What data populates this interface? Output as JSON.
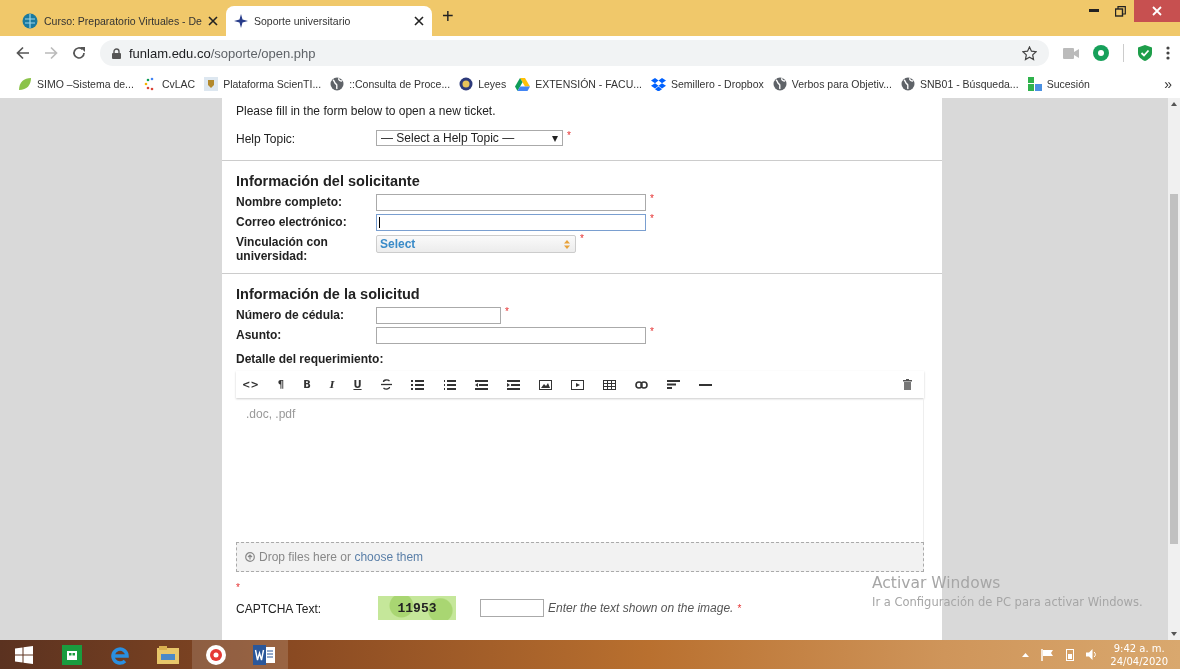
{
  "tabs": [
    {
      "title": "Curso: Preparatorio Virtuales - De",
      "selected": false
    },
    {
      "title": "Soporte universitario",
      "selected": true
    }
  ],
  "new_tab": "+",
  "address": {
    "host": "funlam.edu.co",
    "path": "/soporte/open.php"
  },
  "bookmarks": [
    {
      "label": "SIMO –Sistema de..."
    },
    {
      "label": "CvLAC"
    },
    {
      "label": "Plataforma ScienTI..."
    },
    {
      "label": "::Consulta de Proce..."
    },
    {
      "label": "Leyes"
    },
    {
      "label": "EXTENSIÓN - FACU..."
    },
    {
      "label": "Semillero - Dropbox"
    },
    {
      "label": "Verbos para Objetiv..."
    },
    {
      "label": "SNB01 - Búsqueda..."
    },
    {
      "label": "Sucesión"
    }
  ],
  "bookmarks_more": "»",
  "form": {
    "intro": "Please fill in the form below to open a new ticket.",
    "help_topic": {
      "label": "Help Topic:",
      "value": "— Select a Help Topic —",
      "arrow": "▾",
      "required_mark": "*"
    },
    "sections": [
      {
        "title": "Información del solicitante",
        "fields": [
          {
            "label": "Nombre completo:",
            "kind": "longinput",
            "focused": false,
            "required_mark": "*"
          },
          {
            "label": "Correo electrónico:",
            "kind": "longinput",
            "focused": true,
            "required_mark": "*"
          },
          {
            "label": "Vinculación con universidad:",
            "kind": "select",
            "value": "Select",
            "required_mark": "*"
          }
        ]
      },
      {
        "title": "Información de la solicitud",
        "fields": [
          {
            "label": "Número de cédula:",
            "kind": "shortinput",
            "focused": false,
            "required_mark": "*"
          },
          {
            "label": "Asunto:",
            "kind": "longinput",
            "focused": false,
            "required_mark": "*"
          }
        ]
      }
    ],
    "editor": {
      "label": "**Detalle del requerimiento**:",
      "toolbar_glyphs": [
        "<>",
        "¶",
        "B",
        "I",
        "U"
      ],
      "placeholder": ".doc, .pdf",
      "drop_text": "Drop files here or ",
      "drop_link": "choose them"
    },
    "captcha": {
      "required_mark": "*",
      "label": "CAPTCHA Text:",
      "code": "11953",
      "hint": "Enter the text shown on the image.",
      "hint_mark": "*"
    }
  },
  "activation": {
    "title": "Activar Windows",
    "subtitle": "Ir a Configuración de PC para activar Windows."
  },
  "taskbar": {
    "time": "9:42 a. m.",
    "date": "24/04/2020"
  }
}
